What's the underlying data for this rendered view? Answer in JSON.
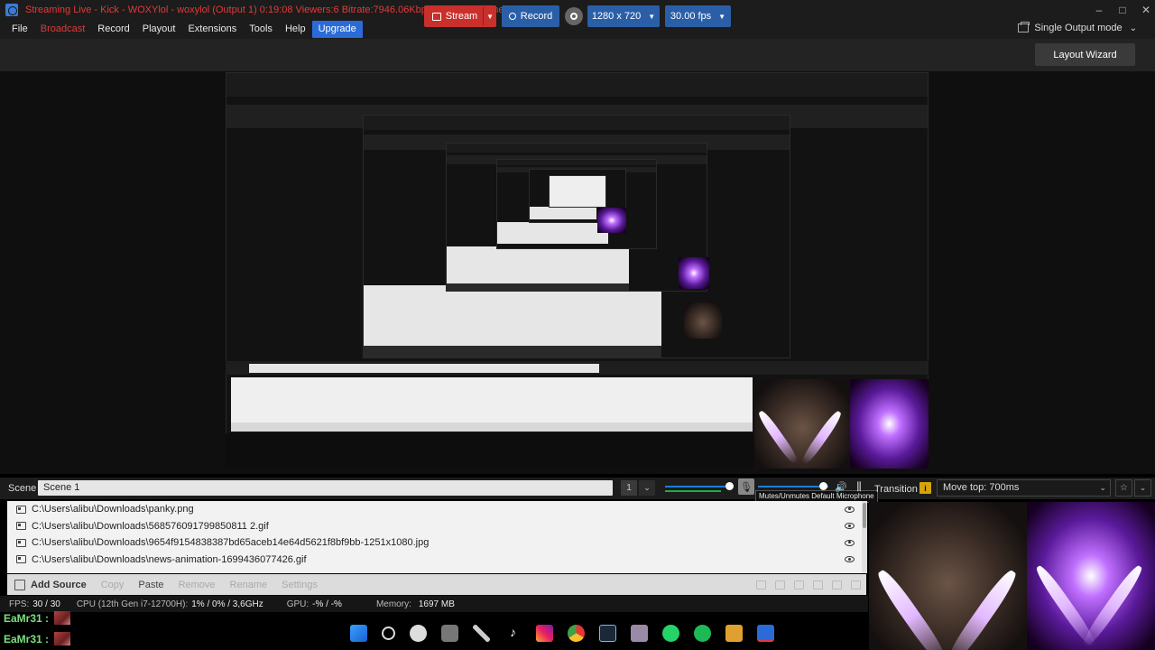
{
  "window": {
    "title": "Streaming Live - Kick - WOXYlol - woxylol (Output 1) 0:19:08  Viewers:6  Bitrate:7946.06Kbps  Dropped Frames: 0",
    "minimize": "–",
    "maximize": "□",
    "close": "✕"
  },
  "menu": {
    "items": [
      "File",
      "Broadcast",
      "Record",
      "Playout",
      "Extensions",
      "Tools",
      "Help",
      "Upgrade"
    ],
    "output_mode": "Single Output mode"
  },
  "toolbar": {
    "stream_label": "Stream",
    "record_label": "Record",
    "resolution": "1280 x 720",
    "fps": "30.00 fps",
    "layout_wizard": "Layout Wizard"
  },
  "scene": {
    "label": "Scene",
    "name": "Scene 1",
    "number": "1",
    "mic_tooltip": "Mutes/Unmutes Default Microphone",
    "transition_label": "Transition",
    "transition_info": "i",
    "transition_value": "Move top: 700ms",
    "audio_level": 0.95,
    "mic_level": 0.95
  },
  "sources": {
    "items": [
      "C:\\Users\\alibu\\Downloads\\panky.png",
      "C:\\Users\\alibu\\Downloads\\568576091799850811 2.gif",
      "C:\\Users\\alibu\\Downloads\\9654f9154838387bd65aceb14e64d5621f8bf9bb-1251x1080.jpg",
      "C:\\Users\\alibu\\Downloads\\news-animation-1699436077426.gif"
    ],
    "add_source": "Add Source",
    "copy": "Copy",
    "paste": "Paste",
    "remove": "Remove",
    "rename": "Rename",
    "settings": "Settings"
  },
  "status": {
    "fps_label": "FPS:",
    "fps_value": "30 / 30",
    "cpu_label": "CPU (12th Gen i7-12700H):",
    "cpu_value": "1% / 0% / 3,6GHz",
    "gpu_label": "GPU:",
    "gpu_value": "-% / -%",
    "memory_label": "Memory:",
    "memory_value": "1697 MB"
  },
  "chat": [
    {
      "user": "EaMr31 :"
    },
    {
      "user": "EaMr31 :"
    }
  ],
  "taskbar_icons": [
    "windows-icon",
    "search-icon",
    "obs-icon",
    "settings-icon",
    "pen-icon",
    "tiktok-icon",
    "instagram-icon",
    "chrome-icon",
    "steam-icon",
    "photos-icon",
    "whatsapp-icon",
    "spotify-icon",
    "folder-icon",
    "app-icon"
  ],
  "colors": {
    "stream": "#c9302c",
    "primary": "#2a5fa8",
    "accent_red": "#e23a3a",
    "chat_green": "#7de07d"
  }
}
